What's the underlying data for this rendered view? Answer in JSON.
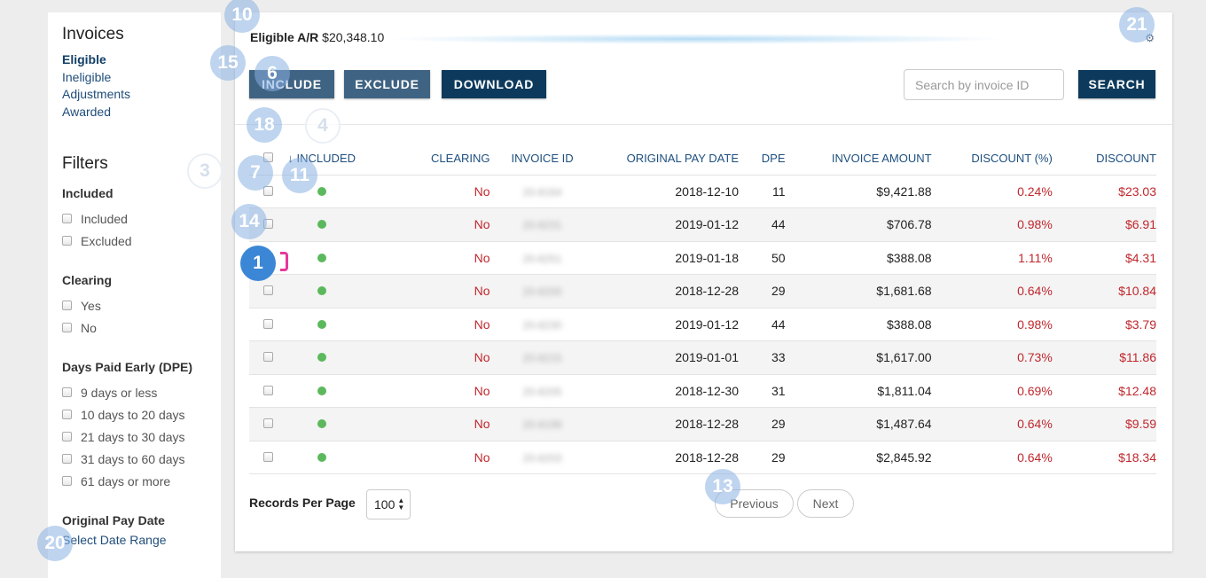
{
  "sidebar": {
    "title": "Invoices",
    "nav": [
      "Eligible",
      "Ineligible",
      "Adjustments",
      "Awarded"
    ],
    "filters_title": "Filters",
    "groups": [
      {
        "title": "Included",
        "options": [
          "Included",
          "Excluded"
        ]
      },
      {
        "title": "Clearing",
        "options": [
          "Yes",
          "No"
        ]
      },
      {
        "title": "Days Paid Early (DPE)",
        "options": [
          "9 days or less",
          "10 days to 20 days",
          "21 days to 30 days",
          "31 days to 60 days",
          "61 days or more"
        ]
      }
    ],
    "date_title": "Original Pay Date",
    "date_link": "Select Date Range"
  },
  "header": {
    "ar_label": "Eligible A/R",
    "ar_value": "$20,348.10",
    "settings_icon": "gear-icon"
  },
  "toolbar": {
    "include": "INCLUDE",
    "exclude": "EXCLUDE",
    "download": "DOWNLOAD",
    "search_placeholder": "Search by invoice ID",
    "search": "SEARCH"
  },
  "table": {
    "sort_arrow": "↓",
    "columns": [
      "INCLUDED",
      "CLEARING",
      "INVOICE ID",
      "ORIGINAL PAY DATE",
      "DPE",
      "INVOICE AMOUNT",
      "DISCOUNT (%)",
      "DISCOUNT"
    ],
    "rows": [
      {
        "clearing": "No",
        "invoice_id": "20-8164",
        "date": "2018-12-10",
        "dpe": "11",
        "amount": "$9,421.88",
        "pct": "0.24%",
        "discount": "$23.03"
      },
      {
        "clearing": "No",
        "invoice_id": "20-8231",
        "date": "2019-01-12",
        "dpe": "44",
        "amount": "$706.78",
        "pct": "0.98%",
        "discount": "$6.91"
      },
      {
        "clearing": "No",
        "invoice_id": "20-8251",
        "date": "2019-01-18",
        "dpe": "50",
        "amount": "$388.08",
        "pct": "1.11%",
        "discount": "$4.31"
      },
      {
        "clearing": "No",
        "invoice_id": "20-8200",
        "date": "2018-12-28",
        "dpe": "29",
        "amount": "$1,681.68",
        "pct": "0.64%",
        "discount": "$10.84"
      },
      {
        "clearing": "No",
        "invoice_id": "20-8230",
        "date": "2019-01-12",
        "dpe": "44",
        "amount": "$388.08",
        "pct": "0.98%",
        "discount": "$3.79"
      },
      {
        "clearing": "No",
        "invoice_id": "20-8215",
        "date": "2019-01-01",
        "dpe": "33",
        "amount": "$1,617.00",
        "pct": "0.73%",
        "discount": "$11.86"
      },
      {
        "clearing": "No",
        "invoice_id": "20-8205",
        "date": "2018-12-30",
        "dpe": "31",
        "amount": "$1,811.04",
        "pct": "0.69%",
        "discount": "$12.48"
      },
      {
        "clearing": "No",
        "invoice_id": "20-8199",
        "date": "2018-12-28",
        "dpe": "29",
        "amount": "$1,487.64",
        "pct": "0.64%",
        "discount": "$9.59"
      },
      {
        "clearing": "No",
        "invoice_id": "20-8203",
        "date": "2018-12-28",
        "dpe": "29",
        "amount": "$2,845.92",
        "pct": "0.64%",
        "discount": "$18.34"
      }
    ]
  },
  "footer": {
    "records_label": "Records Per Page",
    "records_value": "100",
    "prev": "Previous",
    "next": "Next"
  },
  "markers": [
    "10",
    "15",
    "6",
    "21",
    "18",
    "4",
    "3",
    "7",
    "11",
    "14",
    "1",
    "13",
    "20"
  ],
  "colors": {
    "primary_dark": "#0d3a5c",
    "primary": "#3f6383",
    "link": "#1f4d7a",
    "negative": "#c0272d",
    "included_dot": "#5cb85c"
  }
}
